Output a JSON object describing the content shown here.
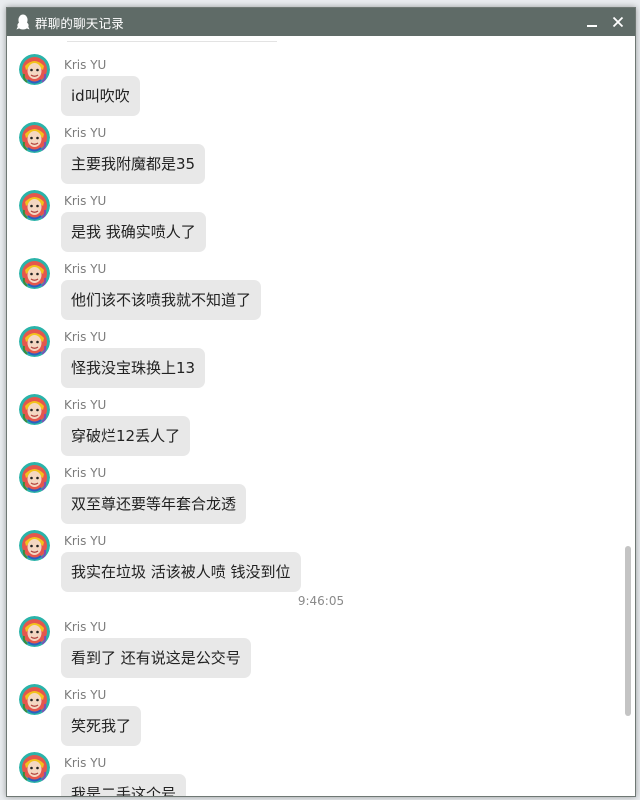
{
  "window": {
    "title": "群聊的聊天记录"
  },
  "messages_before_time": [
    {
      "sender": "Kris YU",
      "text": "id叫吹吹"
    },
    {
      "sender": "Kris YU",
      "text": "主要我附魔都是35"
    },
    {
      "sender": "Kris YU",
      "text": "是我 我确实喷人了"
    },
    {
      "sender": "Kris YU",
      "text": "他们该不该喷我就不知道了"
    },
    {
      "sender": "Kris YU",
      "text": "怪我没宝珠换上13"
    },
    {
      "sender": "Kris YU",
      "text": "穿破烂12丢人了"
    },
    {
      "sender": "Kris YU",
      "text": "双至尊还要等年套合龙透"
    },
    {
      "sender": "Kris YU",
      "text": "我实在垃圾 活该被人喷 钱没到位"
    }
  ],
  "timestamp": "9:46:05",
  "messages_after_time": [
    {
      "sender": "Kris YU",
      "text": "看到了 还有说这是公交号"
    },
    {
      "sender": "Kris YU",
      "text": "笑死我了"
    },
    {
      "sender": "Kris YU",
      "text": "我是二手这个号"
    }
  ],
  "icons": {
    "title": "qq-penguin-icon",
    "minimize": "minimize-icon",
    "close": "close-icon"
  },
  "colors": {
    "titlebar": "#5f6b67",
    "bubble": "#e8e8e8",
    "name": "#7b7b7b"
  }
}
